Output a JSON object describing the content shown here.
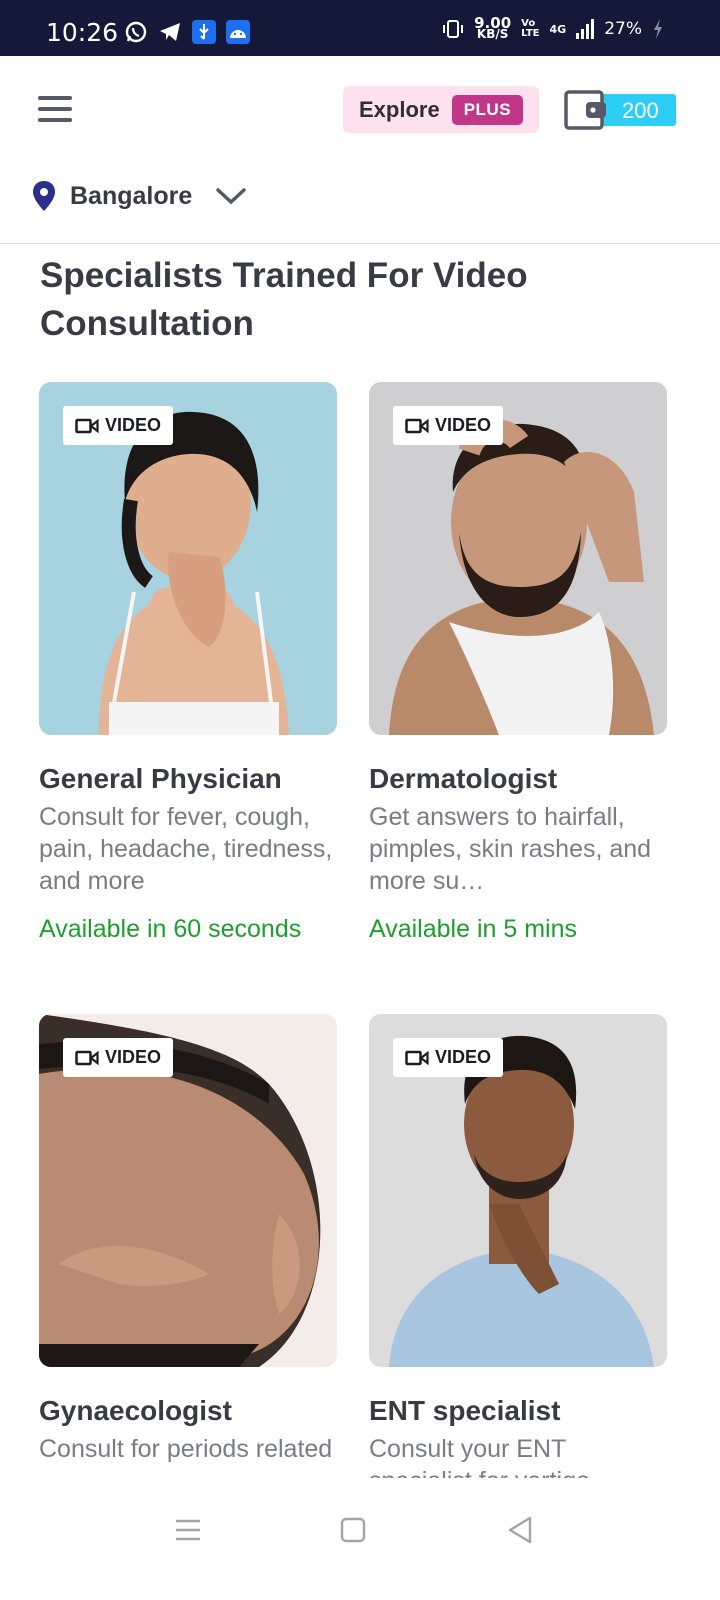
{
  "status_bar": {
    "time": "10:26",
    "net_speed_value": "9.00",
    "net_speed_unit": "KB/S",
    "volte_top": "Vo",
    "volte_bottom": "LTE",
    "network": "4G",
    "battery": "27%"
  },
  "header": {
    "explore_label": "Explore",
    "plus_label": "PLUS",
    "wallet_value": "200"
  },
  "location": {
    "city": "Bangalore"
  },
  "section": {
    "title": "Specialists Trained For Video Consultation"
  },
  "colors": {
    "status_bg": "#14193a",
    "explore_bg": "#fde1ef",
    "plus_badge": "#c2368a",
    "wallet_accent": "#2dcef5",
    "available_green": "#1e9e2e"
  },
  "cards": [
    {
      "tag": "VIDEO",
      "name": "General Physician",
      "desc": "Consult for fever, cough, pain, headache, tiredness, and more",
      "availability": "Available in 60 seconds"
    },
    {
      "tag": "VIDEO",
      "name": "Dermatologist",
      "desc": "Get answers to hairfall, pimples, skin rashes, and more su…",
      "availability": "Available in 5 mins"
    },
    {
      "tag": "VIDEO",
      "name": "Gynaecologist",
      "desc": "Consult for periods related",
      "availability": ""
    },
    {
      "tag": "VIDEO",
      "name": "ENT specialist",
      "desc": "Consult your ENT specialist for vertigo",
      "availability": ""
    }
  ]
}
